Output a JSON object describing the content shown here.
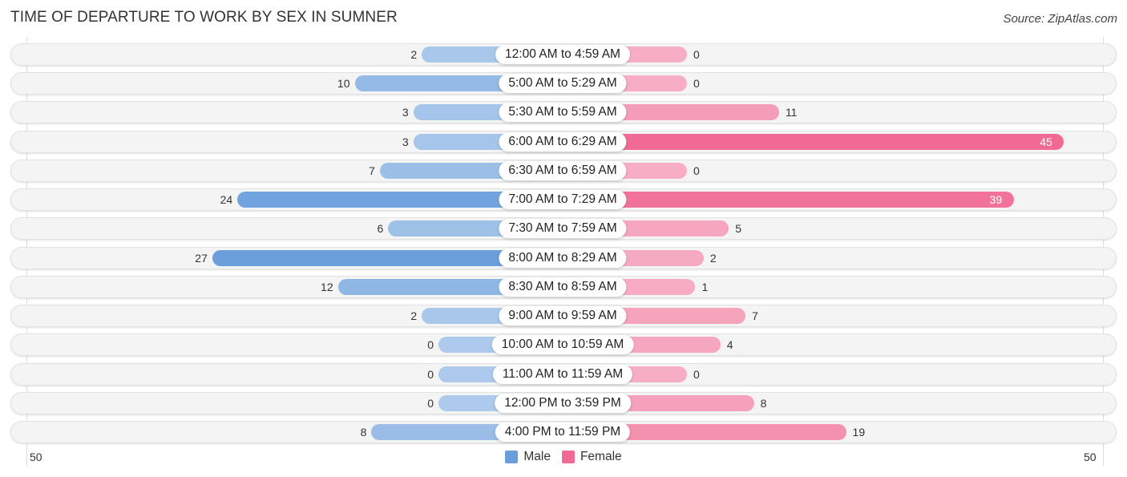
{
  "chart_data": {
    "type": "bar",
    "orientation": "horizontal-diverging",
    "title": "TIME OF DEPARTURE TO WORK BY SEX IN SUMNER",
    "source": "Source: ZipAtlas.com",
    "categories": [
      "12:00 AM to 4:59 AM",
      "5:00 AM to 5:29 AM",
      "5:30 AM to 5:59 AM",
      "6:00 AM to 6:29 AM",
      "6:30 AM to 6:59 AM",
      "7:00 AM to 7:29 AM",
      "7:30 AM to 7:59 AM",
      "8:00 AM to 8:29 AM",
      "8:30 AM to 8:59 AM",
      "9:00 AM to 9:59 AM",
      "10:00 AM to 10:59 AM",
      "11:00 AM to 11:59 AM",
      "12:00 PM to 3:59 PM",
      "4:00 PM to 11:59 PM"
    ],
    "series": [
      {
        "name": "Male",
        "color": "#6a9fdc",
        "values": [
          2,
          10,
          3,
          3,
          7,
          24,
          6,
          27,
          12,
          2,
          0,
          0,
          0,
          8
        ]
      },
      {
        "name": "Female",
        "color": "#f06a93",
        "values": [
          0,
          0,
          11,
          45,
          0,
          39,
          5,
          2,
          1,
          7,
          4,
          0,
          8,
          19
        ]
      }
    ],
    "axis": {
      "left_tick": "50",
      "right_tick": "50",
      "max": 50
    },
    "legend": {
      "position": "bottom-center",
      "items": [
        "Male",
        "Female"
      ]
    },
    "grid": false
  }
}
